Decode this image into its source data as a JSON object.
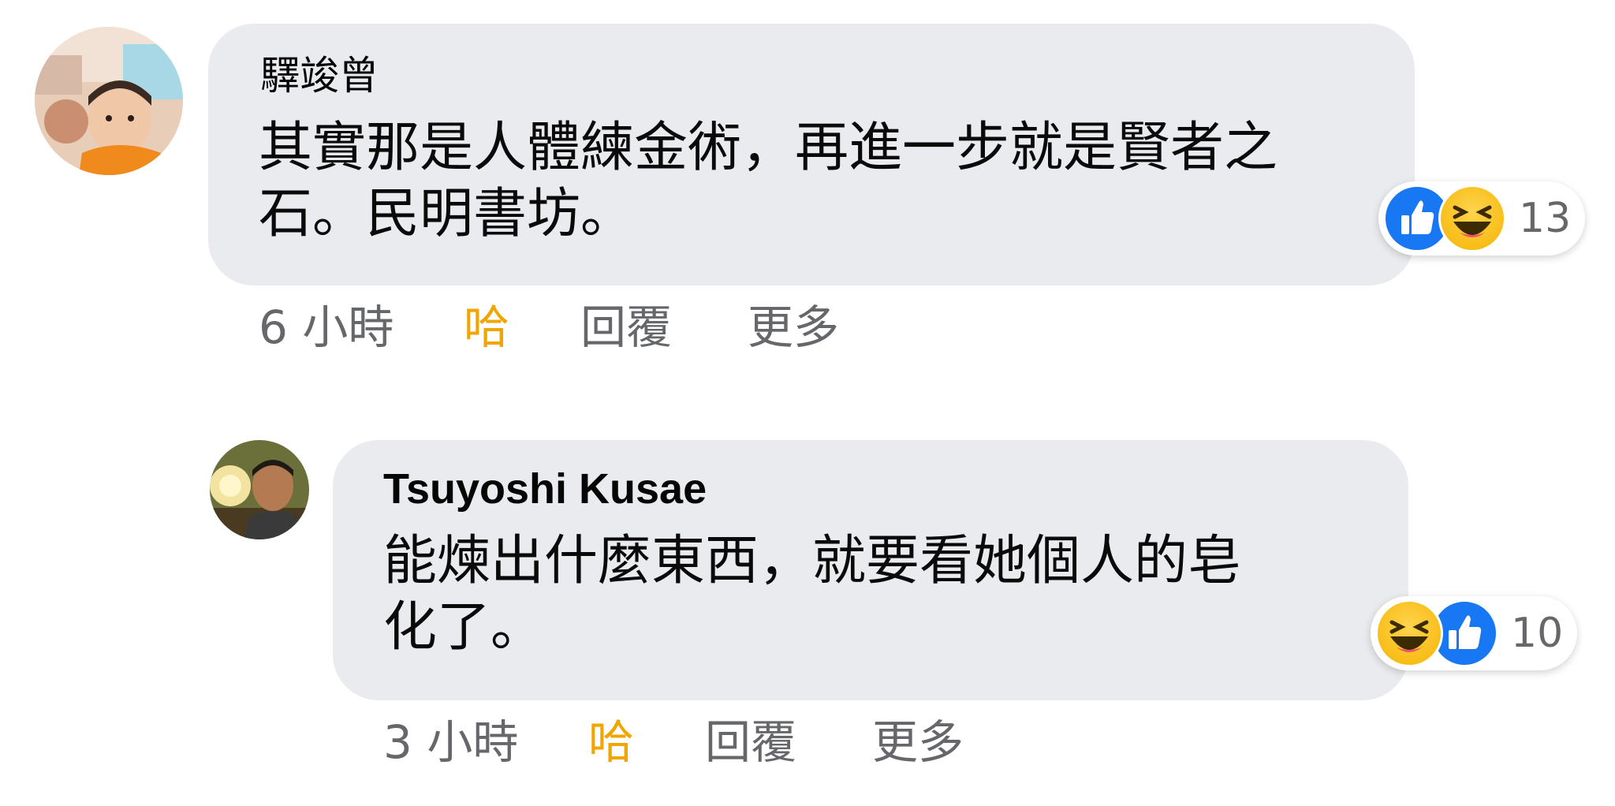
{
  "comments": [
    {
      "author": "驛竣曾",
      "text_line1": "其實那是人體練金術，再進一步就是賢者之",
      "text_line2": "石。民明書坊。",
      "reaction_icons": [
        "like-icon",
        "haha-icon"
      ],
      "reaction_count": "13",
      "time": "6 小時",
      "reaction_label": "哈",
      "reply_label": "回覆",
      "more_label": "更多"
    },
    {
      "author": "Tsuyoshi Kusae",
      "text_line1": "能煉出什麼東西，就要看她個人的皂",
      "text_line2": "化了。",
      "reaction_icons": [
        "haha-icon",
        "like-icon"
      ],
      "reaction_count": "10",
      "time": "3 小時",
      "reaction_label": "哈",
      "reply_label": "回覆",
      "more_label": "更多"
    }
  ],
  "colors": {
    "bubble": "#eaebee",
    "secondary_text": "#65676b",
    "haha_accent": "#f0a500",
    "like_blue": "#1877f2"
  }
}
